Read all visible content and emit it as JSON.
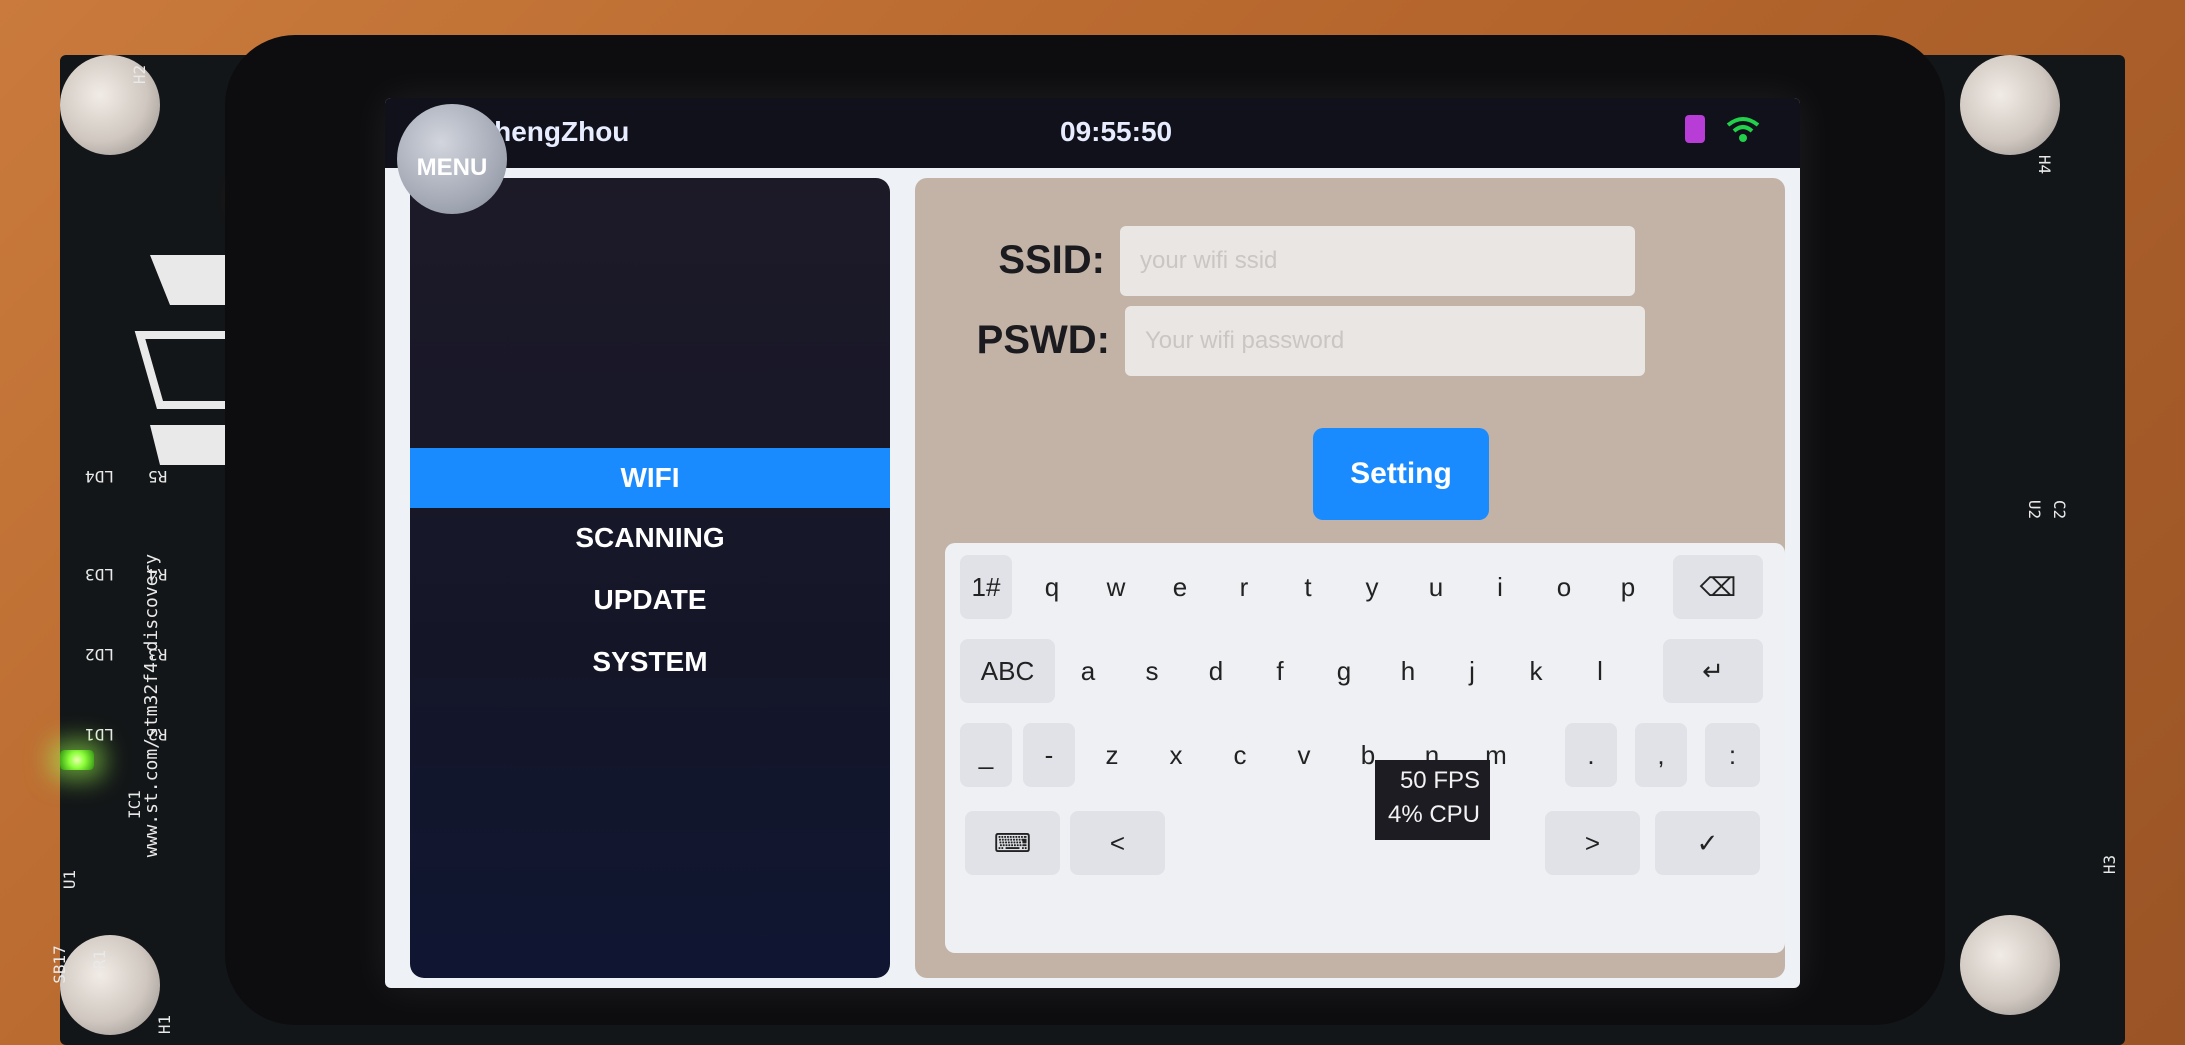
{
  "board": {
    "silkscreen": [
      "H2",
      "H4",
      "H1",
      "H3",
      "LD4",
      "LD3",
      "LD2",
      "LD1",
      "R5",
      "R4",
      "R3",
      "R2",
      "U1",
      "IC1",
      "SB17",
      "R1",
      "U2",
      "C2",
      "www.st.com/stm32f4-discovery"
    ]
  },
  "statusbar": {
    "menu_label": "MENU",
    "location": "ZhengZhou",
    "time": "09:55:50",
    "battery_color": "#b83cd6",
    "wifi_color": "#22d04a"
  },
  "sidebar": {
    "items": [
      {
        "label": "WIFI",
        "active": true
      },
      {
        "label": "SCANNING",
        "active": false
      },
      {
        "label": "UPDATE",
        "active": false
      },
      {
        "label": "SYSTEM",
        "active": false
      }
    ]
  },
  "form": {
    "ssid_label": "SSID:",
    "ssid_placeholder": "your wifi ssid",
    "pswd_label": "PSWD:",
    "pswd_placeholder": "Your wifi password",
    "setting_button": "Setting",
    "accent_color": "#1a8bff"
  },
  "keyboard": {
    "row1": [
      "1#",
      "q",
      "w",
      "e",
      "r",
      "t",
      "y",
      "u",
      "i",
      "o",
      "p",
      "⌫"
    ],
    "row2": [
      "ABC",
      "a",
      "s",
      "d",
      "f",
      "g",
      "h",
      "j",
      "k",
      "l",
      "↵"
    ],
    "row3": [
      "_",
      "-",
      "z",
      "x",
      "c",
      "v",
      "b",
      "n",
      "m",
      ".",
      ",",
      ":"
    ],
    "row4": [
      "⌨",
      "<",
      ">",
      "✓"
    ]
  },
  "perf": {
    "fps": "50 FPS",
    "cpu": "4% CPU"
  }
}
